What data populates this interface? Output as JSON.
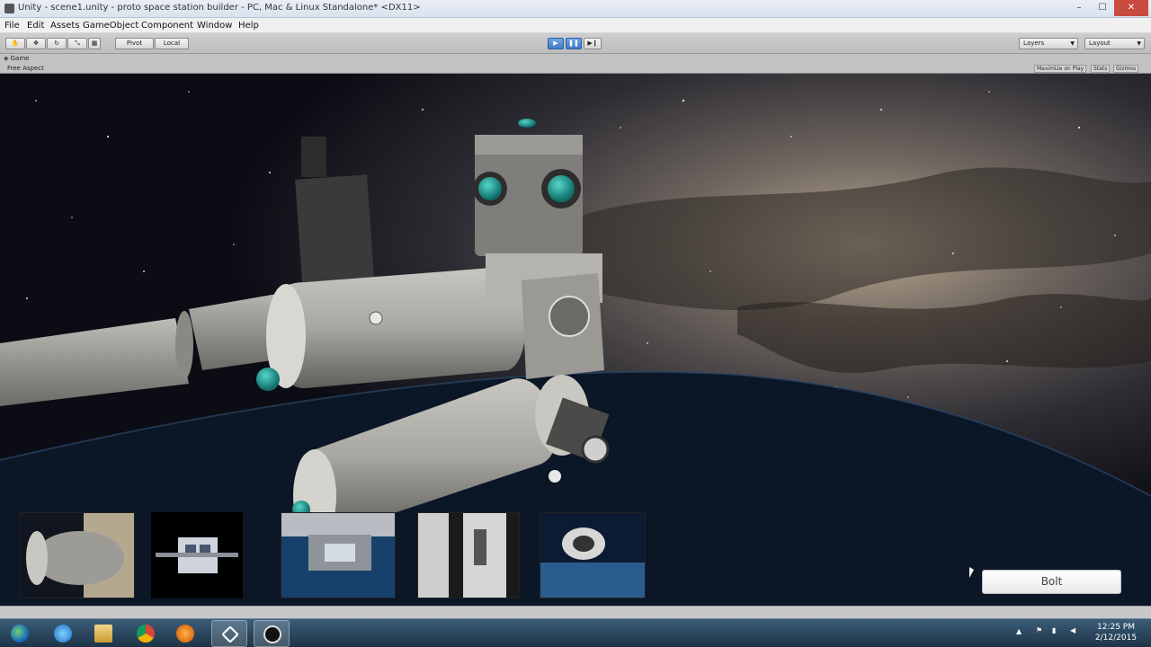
{
  "window": {
    "title": "Unity - scene1.unity - proto space station builder - PC, Mac & Linux Standalone* <DX11>",
    "controls": {
      "minimize": "–",
      "maximize": "☐",
      "close": "✕"
    }
  },
  "menu": [
    "File",
    "Edit",
    "Assets",
    "GameObject",
    "Component",
    "Window",
    "Help"
  ],
  "toolbar": {
    "pivot_label": "Pivot",
    "local_label": "Local",
    "layers_label": "Layers",
    "layout_label": "Layout"
  },
  "game_view": {
    "tab_label": "Game",
    "aspect_label": "Free Aspect",
    "maximize_on_play": "Maximize on Play",
    "stats": "Stats",
    "gizmos": "Gizmos"
  },
  "buttons": {
    "bolt": "Bolt"
  },
  "taskbar": {
    "time": "12:25 PM",
    "date": "2/12/2015"
  }
}
